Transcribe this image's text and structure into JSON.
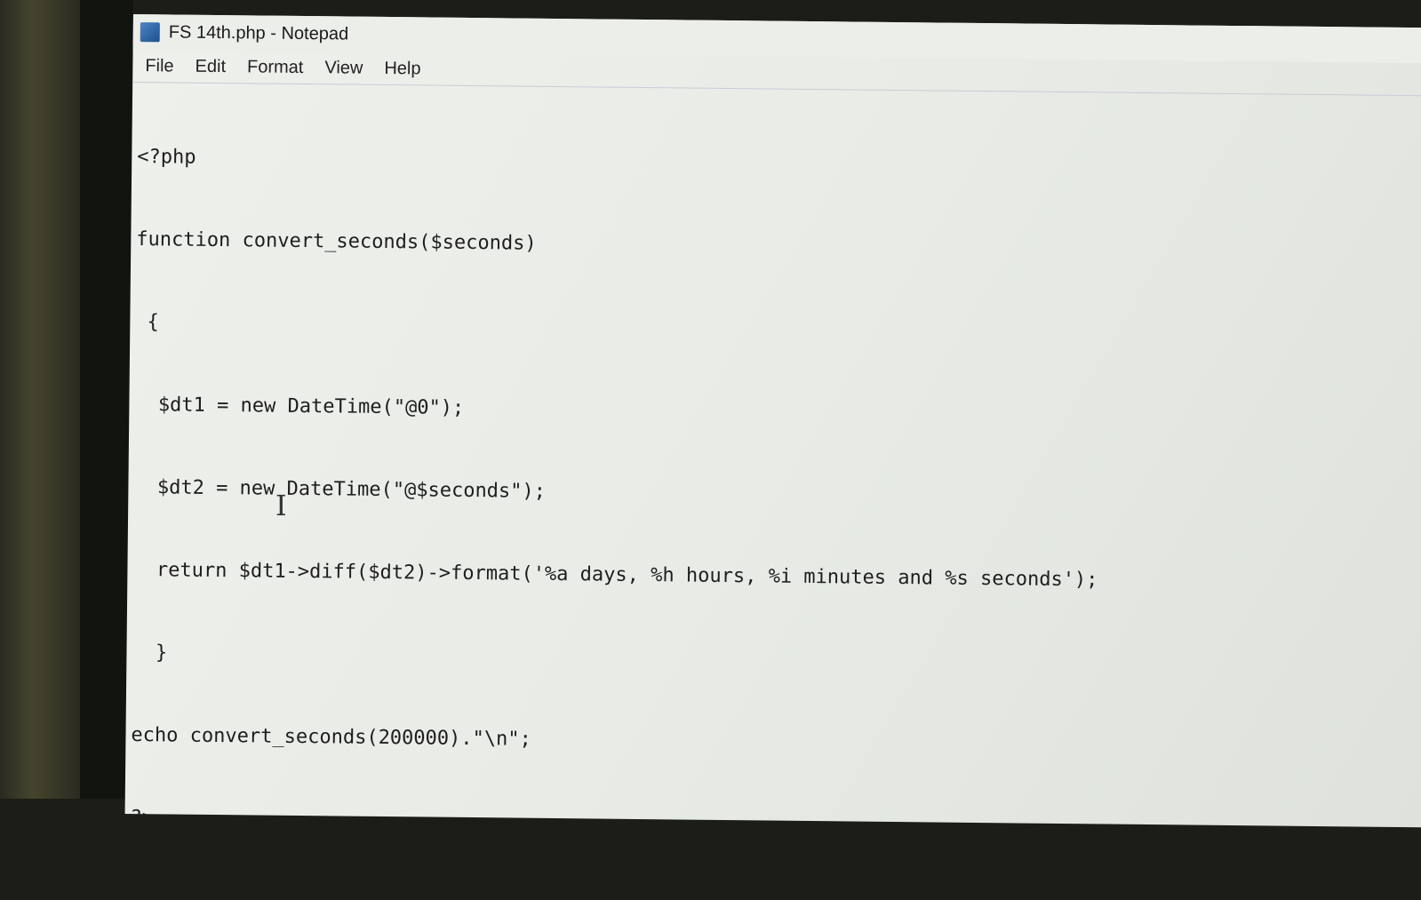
{
  "window": {
    "title": "FS 14th.php - Notepad",
    "icon": "notepad-icon"
  },
  "menu": [
    "File",
    "Edit",
    "Format",
    "View",
    "Help"
  ],
  "editor": {
    "lines": [
      "<?php",
      "function convert_seconds($seconds)",
      " {",
      "  $dt1 = new DateTime(\"@0\");",
      "  $dt2 = new DateTime(\"@$seconds\");",
      "  return $dt1->diff($dt2)->format('%a days, %h hours, %i minutes and %s seconds');",
      "  }",
      "echo convert_seconds(200000).\"\\n\";",
      "?>"
    ]
  },
  "mouse_cursor": "text-cursor-icon"
}
